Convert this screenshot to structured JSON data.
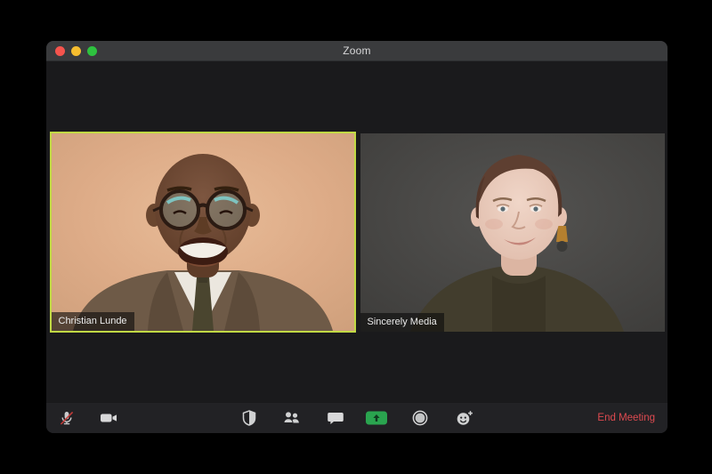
{
  "window": {
    "title": "Zoom",
    "controls": {
      "close_color": "#f5544d",
      "minimize_color": "#f6bd2f",
      "fullscreen_color": "#2ec23f"
    }
  },
  "participants": [
    {
      "name": "Christian Lunde",
      "active_speaker": true
    },
    {
      "name": "Sincerely Media",
      "active_speaker": false
    }
  ],
  "toolbar": {
    "buttons": [
      {
        "icon": "microphone-muted-icon",
        "state": "muted"
      },
      {
        "icon": "video-camera-icon",
        "state": "on"
      },
      {
        "icon": "security-shield-icon"
      },
      {
        "icon": "participants-icon"
      },
      {
        "icon": "chat-bubble-icon"
      },
      {
        "icon": "share-screen-icon"
      },
      {
        "icon": "record-icon"
      },
      {
        "icon": "reactions-smiley-icon"
      }
    ],
    "end_meeting_label": "End Meeting"
  },
  "colors": {
    "active_speaker_border": "#c1d944",
    "end_meeting_text": "#de4a50",
    "share_button_green": "#2aa44f",
    "mic_muted_slash": "#c23b38",
    "titlebar": "#3a3b3d",
    "toolbar": "#222225",
    "window_body": "#1a1a1c",
    "icon_gray": "#cfd0d1"
  }
}
